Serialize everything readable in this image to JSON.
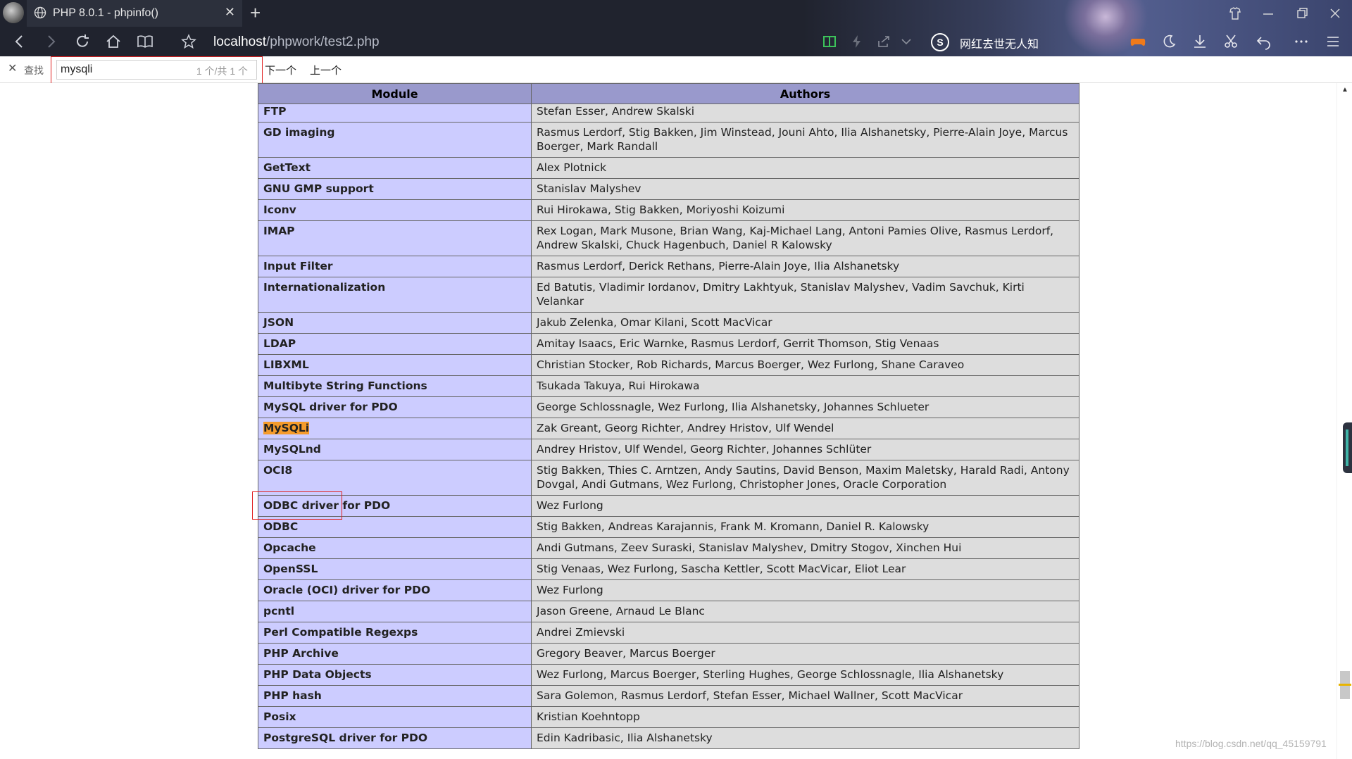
{
  "browser": {
    "tab_title": "PHP 8.0.1 - phpinfo()",
    "url_host": "localhost",
    "url_path": "/phpwork/test2.php",
    "news_ticker": "网红去世无人知",
    "search_engine_glyph": "S"
  },
  "find_bar": {
    "label": "查找",
    "query": "mysqli",
    "count": "1 个/共 1 个",
    "next_label": "下一个",
    "prev_label": "上一个"
  },
  "table": {
    "headers": [
      "Module",
      "Authors"
    ],
    "rows": [
      {
        "module": "FTP",
        "authors": "Stefan Esser, Andrew Skalski"
      },
      {
        "module": "GD imaging",
        "authors": "Rasmus Lerdorf, Stig Bakken, Jim Winstead, Jouni Ahto, Ilia Alshanetsky, Pierre-Alain Joye, Marcus Boerger, Mark Randall"
      },
      {
        "module": "GetText",
        "authors": "Alex Plotnick"
      },
      {
        "module": "GNU GMP support",
        "authors": "Stanislav Malyshev"
      },
      {
        "module": "Iconv",
        "authors": "Rui Hirokawa, Stig Bakken, Moriyoshi Koizumi"
      },
      {
        "module": "IMAP",
        "authors": "Rex Logan, Mark Musone, Brian Wang, Kaj-Michael Lang, Antoni Pamies Olive, Rasmus Lerdorf, Andrew Skalski, Chuck Hagenbuch, Daniel R Kalowsky"
      },
      {
        "module": "Input Filter",
        "authors": "Rasmus Lerdorf, Derick Rethans, Pierre-Alain Joye, Ilia Alshanetsky"
      },
      {
        "module": "Internationalization",
        "authors": "Ed Batutis, Vladimir Iordanov, Dmitry Lakhtyuk, Stanislav Malyshev, Vadim Savchuk, Kirti Velankar"
      },
      {
        "module": "JSON",
        "authors": "Jakub Zelenka, Omar Kilani, Scott MacVicar"
      },
      {
        "module": "LDAP",
        "authors": "Amitay Isaacs, Eric Warnke, Rasmus Lerdorf, Gerrit Thomson, Stig Venaas"
      },
      {
        "module": "LIBXML",
        "authors": "Christian Stocker, Rob Richards, Marcus Boerger, Wez Furlong, Shane Caraveo"
      },
      {
        "module": "Multibyte String Functions",
        "authors": "Tsukada Takuya, Rui Hirokawa"
      },
      {
        "module": "MySQL driver for PDO",
        "authors": "George Schlossnagle, Wez Furlong, Ilia Alshanetsky, Johannes Schlueter"
      },
      {
        "module": "MySQLi",
        "authors": "Zak Greant, Georg Richter, Andrey Hristov, Ulf Wendel",
        "highlight": true
      },
      {
        "module": "MySQLnd",
        "authors": "Andrey Hristov, Ulf Wendel, Georg Richter, Johannes Schlüter"
      },
      {
        "module": "OCI8",
        "authors": "Stig Bakken, Thies C. Arntzen, Andy Sautins, David Benson, Maxim Maletsky, Harald Radi, Antony Dovgal, Andi Gutmans, Wez Furlong, Christopher Jones, Oracle Corporation"
      },
      {
        "module": "ODBC driver for PDO",
        "authors": "Wez Furlong"
      },
      {
        "module": "ODBC",
        "authors": "Stig Bakken, Andreas Karajannis, Frank M. Kromann, Daniel R. Kalowsky"
      },
      {
        "module": "Opcache",
        "authors": "Andi Gutmans, Zeev Suraski, Stanislav Malyshev, Dmitry Stogov, Xinchen Hui"
      },
      {
        "module": "OpenSSL",
        "authors": "Stig Venaas, Wez Furlong, Sascha Kettler, Scott MacVicar, Eliot Lear"
      },
      {
        "module": "Oracle (OCI) driver for PDO",
        "authors": "Wez Furlong"
      },
      {
        "module": "pcntl",
        "authors": "Jason Greene, Arnaud Le Blanc"
      },
      {
        "module": "Perl Compatible Regexps",
        "authors": "Andrei Zmievski"
      },
      {
        "module": "PHP Archive",
        "authors": "Gregory Beaver, Marcus Boerger"
      },
      {
        "module": "PHP Data Objects",
        "authors": "Wez Furlong, Marcus Boerger, Sterling Hughes, George Schlossnagle, Ilia Alshanetsky"
      },
      {
        "module": "PHP hash",
        "authors": "Sara Golemon, Rasmus Lerdorf, Stefan Esser, Michael Wallner, Scott MacVicar"
      },
      {
        "module": "Posix",
        "authors": "Kristian Koehntopp"
      },
      {
        "module": "PostgreSQL driver for PDO",
        "authors": "Edin Kadribasic, Ilia Alshanetsky"
      }
    ]
  },
  "watermark": "https://blog.csdn.net/qq_45159791",
  "colors": {
    "header_bg": "#9999cc",
    "module_bg": "#ccccff",
    "authors_bg": "#dddddd",
    "match_highlight": "#f59b2b",
    "annotation_box": "#e02020"
  }
}
